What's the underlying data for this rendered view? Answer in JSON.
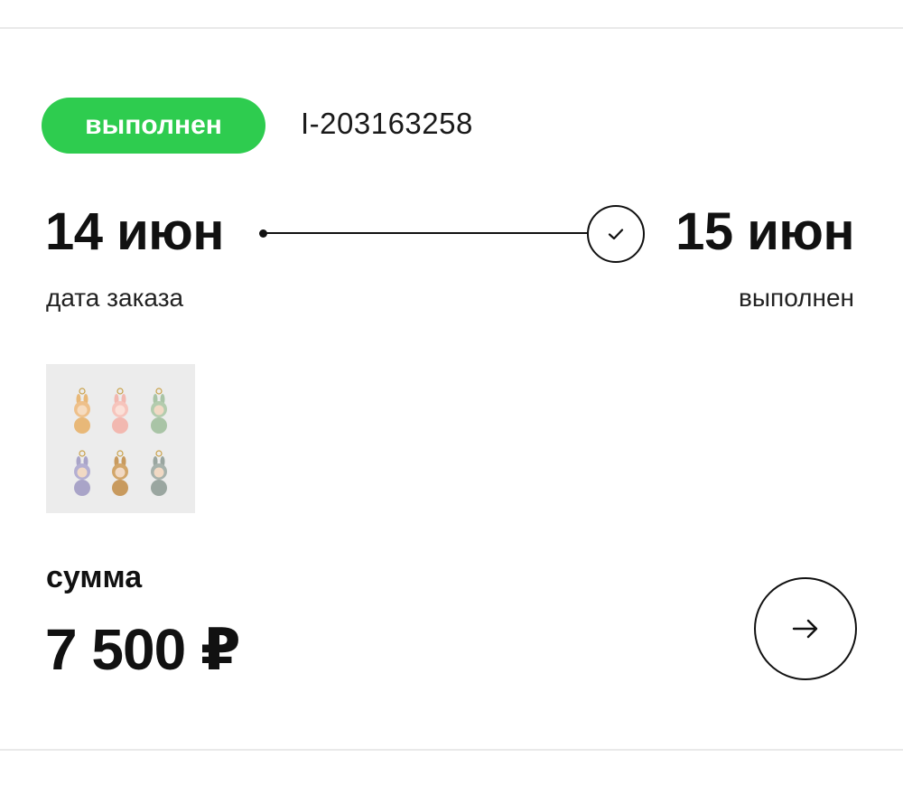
{
  "order": {
    "status_label": "выполнен",
    "order_id": "I-203163258"
  },
  "timeline": {
    "start_date": "14 июн",
    "start_label": "дата заказа",
    "end_date": "15 июн",
    "end_label": "выполнен"
  },
  "total": {
    "label": "сумма",
    "value": "7 500 ₽"
  },
  "colors": {
    "status_green": "#2ecc4f",
    "text": "#111111",
    "thumb_bg": "#ececec"
  },
  "icons": {
    "status_check": "check-circle-icon",
    "open_order": "arrow-right-icon"
  }
}
